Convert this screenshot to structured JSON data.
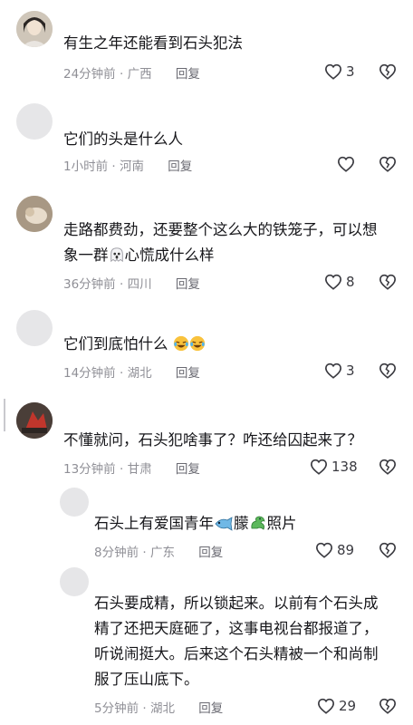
{
  "comments": [
    {
      "username": "",
      "text": "有生之年还能看到石头犯法",
      "time": "24分钟前",
      "location": "广西",
      "reply_label": "回复",
      "likes": "3"
    },
    {
      "username": "",
      "text": "它们的头是什么人",
      "time": "1小时前",
      "location": "河南",
      "reply_label": "回复",
      "likes": ""
    },
    {
      "username": "",
      "text_line1": "走路都费劲，还要整个这么大的铁笼子，可以想",
      "text_line2_pre": "象一群",
      "text_line2_post": "心慌成什么样",
      "time": "36分钟前",
      "location": "四川",
      "reply_label": "回复",
      "likes": "8"
    },
    {
      "username": "",
      "text": "它们到底怕什么",
      "time": "14分钟前",
      "location": "湖北",
      "reply_label": "回复",
      "likes": "3"
    },
    {
      "username": "",
      "text": "不懂就问，石头犯啥事了？咋还给囚起来了？",
      "time": "13分钟前",
      "location": "甘肃",
      "reply_label": "回复",
      "likes": "138"
    }
  ],
  "replies": [
    {
      "username": "",
      "text_pre": "石头上有爱国青年",
      "text_mid": "朦",
      "text_post": "照片",
      "time": "8分钟前",
      "location": "广东",
      "reply_label": "回复",
      "likes": "89"
    },
    {
      "username": "",
      "text_line1": "石头要成精，所以锁起来。以前有个石头成",
      "text_line2": "精了还把天庭砸了，这事电视台都报道了，",
      "text_line3": "听说闹挺大。后来这个石头精被一个和尚制",
      "text_line4": "服了压山底下。",
      "time": "5分钟前",
      "location": "湖北",
      "reply_label": "回复",
      "likes": "29"
    }
  ],
  "icons": {
    "like": "heart-outline-icon",
    "dislike": "broken-heart-icon"
  },
  "colors": {
    "text": "#16161a",
    "meta": "#8f8f96",
    "avatar_bg": "#e6e6e8"
  }
}
